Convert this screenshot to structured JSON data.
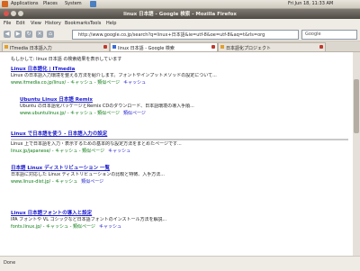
{
  "panel": {
    "apps": "Applications",
    "places": "Places",
    "system": "System",
    "clock": "Fri Jun 18, 11:33 AM"
  },
  "window": {
    "title": "linux 日本語 - Google 検索 - Mozilla Firefox"
  },
  "menu": [
    "File",
    "Edit",
    "View",
    "History",
    "Bookmarks",
    "Tools",
    "Help"
  ],
  "nav": {
    "back": "◀",
    "forward": "▶",
    "reload": "↻",
    "stop": "✕",
    "home": "⌂",
    "url": "http://www.google.co.jp/search?q=linux+日本語&ie=utf-8&oe=utf-8&aq=t&rls=org",
    "search_placeholder": "Google"
  },
  "tabs": [
    {
      "label": "ITmedia 日本語入力"
    },
    {
      "label": "linux 日本語 - Google 検索"
    },
    {
      "label": "日本語化プロジェクト"
    }
  ],
  "hint": "もしかして: linux 日本語 の検索結果を表示しています",
  "results": [
    {
      "title": "Linux 日本語化 | ITmedia",
      "snippet": "Linux の日本語入力環境を整える方法を紹介します。フォントやインプットメソッドの設定について...",
      "url": "www.itmedia.co.jp/linux/ - キャッシュ - 類似ページ",
      "link": "キャッシュ"
    },
    {
      "title": "Ubuntu Linux 日本語 Remix",
      "snippet": "Ubuntu の日本語化パッケージとRemix CDのダウンロード、日本語環境の導入手順...",
      "url": "www.ubuntulinux.jp/ - キャッシュ - 類似ページ",
      "link": "類似ページ"
    },
    {
      "title": "Linux で日本語を使う - 日本語入力の設定",
      "snippet": "Linux 上で日本語を入力・表示するための基本的な設定方法をまとめたページです...",
      "url": "linux.jp/japanese/ - キャッシュ - 類似ページ",
      "link": "キャッシュ"
    },
    {
      "title": "日本語 Linux ディストリビューション 一覧",
      "snippet": "日本語に対応した Linux ディストリビューションの比較と特徴、入手方法...",
      "url": "www.linux-dist.jp/ - キャッシュ",
      "link": "類似ページ"
    },
    {
      "title": "Linux 日本語フォントの導入と設定",
      "snippet": "IPA フォントや VL ゴシックなど日本語フォントのインストール方法を解説...",
      "url": "fonts.linux.jp/ - キャッシュ - 類似ページ",
      "link": "キャッシュ"
    }
  ],
  "status": "Done"
}
